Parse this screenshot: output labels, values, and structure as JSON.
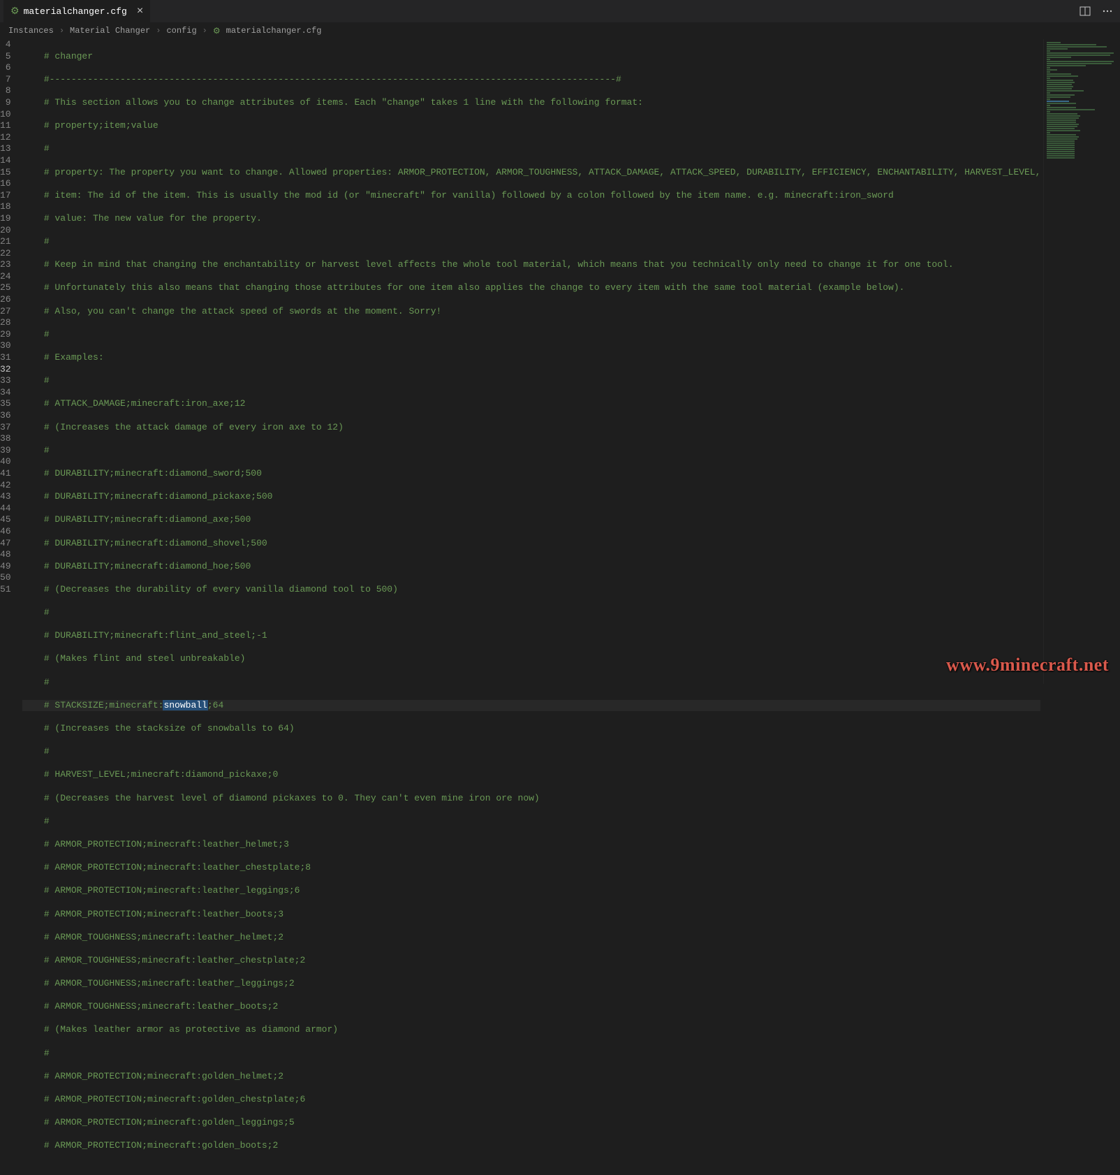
{
  "tab": {
    "label": "materialchanger.cfg"
  },
  "breadcrumbs": {
    "b0": "Instances",
    "b1": "Material Changer",
    "b2": "config",
    "b3": "materialchanger.cfg"
  },
  "watermark": "www.9minecraft.net",
  "code": {
    "l4": "    # changer",
    "l5": "    #--------------------------------------------------------------------------------------------------------#",
    "l6": "    # This section allows you to change attributes of items. Each \"change\" takes 1 line with the following format:",
    "l7": "    # property;item;value",
    "l8": "    #",
    "l9": "    # property: The property you want to change. Allowed properties: ARMOR_PROTECTION, ARMOR_TOUGHNESS, ATTACK_DAMAGE, ATTACK_SPEED, DURABILITY, EFFICIENCY, ENCHANTABILITY, HARVEST_LEVEL,",
    "l10": "    # item: The id of the item. This is usually the mod id (or \"minecraft\" for vanilla) followed by a colon followed by the item name. e.g. minecraft:iron_sword",
    "l11": "    # value: The new value for the property.",
    "l12": "    #",
    "l13": "    # Keep in mind that changing the enchantability or harvest level affects the whole tool material, which means that you technically only need to change it for one tool.",
    "l14": "    # Unfortunately this also means that changing those attributes for one item also applies the change to every item with the same tool material (example below).",
    "l15": "    # Also, you can't change the attack speed of swords at the moment. Sorry!",
    "l16": "    #",
    "l17": "    # Examples:",
    "l18": "    #",
    "l19": "    # ATTACK_DAMAGE;minecraft:iron_axe;12",
    "l20": "    # (Increases the attack damage of every iron axe to 12)",
    "l21": "    #",
    "l22": "    # DURABILITY;minecraft:diamond_sword;500",
    "l23": "    # DURABILITY;minecraft:diamond_pickaxe;500",
    "l24": "    # DURABILITY;minecraft:diamond_axe;500",
    "l25": "    # DURABILITY;minecraft:diamond_shovel;500",
    "l26": "    # DURABILITY;minecraft:diamond_hoe;500",
    "l27": "    # (Decreases the durability of every vanilla diamond tool to 500)",
    "l28": "    #",
    "l29": "    # DURABILITY;minecraft:flint_and_steel;-1",
    "l30": "    # (Makes flint and steel unbreakable)",
    "l31": "    #",
    "l32_a": "    # STACKSIZE;minecraft:",
    "l32_hl": "snowball",
    "l32_b": ";64",
    "l33": "    # (Increases the stacksize of snowballs to 64)",
    "l34": "    #",
    "l35": "    # HARVEST_LEVEL;minecraft:diamond_pickaxe;0",
    "l36": "    # (Decreases the harvest level of diamond pickaxes to 0. They can't even mine iron ore now)",
    "l37": "    #",
    "l38": "    # ARMOR_PROTECTION;minecraft:leather_helmet;3",
    "l39": "    # ARMOR_PROTECTION;minecraft:leather_chestplate;8",
    "l40": "    # ARMOR_PROTECTION;minecraft:leather_leggings;6",
    "l41": "    # ARMOR_PROTECTION;minecraft:leather_boots;3",
    "l42": "    # ARMOR_TOUGHNESS;minecraft:leather_helmet;2",
    "l43": "    # ARMOR_TOUGHNESS;minecraft:leather_chestplate;2",
    "l44": "    # ARMOR_TOUGHNESS;minecraft:leather_leggings;2",
    "l45": "    # ARMOR_TOUGHNESS;minecraft:leather_boots;2",
    "l46": "    # (Makes leather armor as protective as diamond armor)",
    "l47": "    #",
    "l48": "    # ARMOR_PROTECTION;minecraft:golden_helmet;2",
    "l49": "    # ARMOR_PROTECTION;minecraft:golden_chestplate;6",
    "l50": "    # ARMOR_PROTECTION;minecraft:golden_leggings;5",
    "l51": "    # ARMOR_PROTECTION;minecraft:golden_boots;2"
  },
  "lineNumbers": [
    "4",
    "5",
    "6",
    "7",
    "8",
    "9",
    "10",
    "11",
    "12",
    "13",
    "14",
    "15",
    "16",
    "17",
    "18",
    "19",
    "20",
    "21",
    "22",
    "23",
    "24",
    "25",
    "26",
    "27",
    "28",
    "29",
    "30",
    "31",
    "32",
    "33",
    "34",
    "35",
    "36",
    "37",
    "38",
    "39",
    "40",
    "41",
    "42",
    "43",
    "44",
    "45",
    "46",
    "47",
    "48",
    "49",
    "50",
    "51"
  ]
}
